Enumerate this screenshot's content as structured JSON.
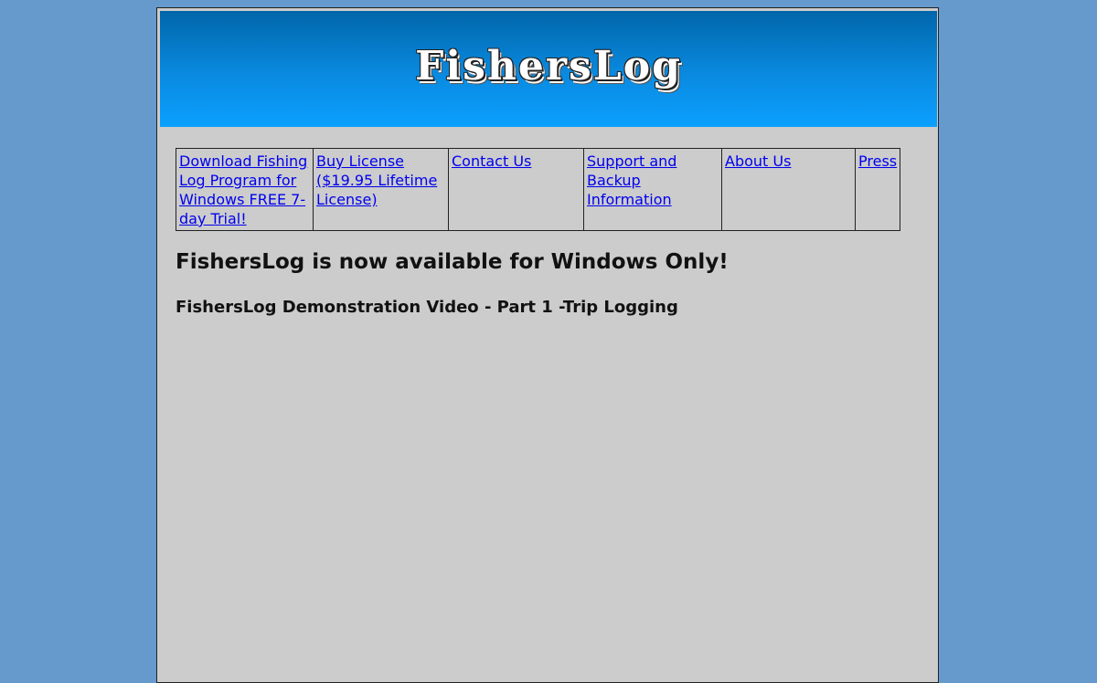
{
  "header": {
    "logo_text": "FishersLog",
    "gradient_top": "#0066aa",
    "gradient_bottom": "#0aa0ff"
  },
  "nav": {
    "items": [
      {
        "label": "Download Fishing Log Program for Windows  FREE 7-day Trial!"
      },
      {
        "label": "Buy License ($19.95 Lifetime License)"
      },
      {
        "label": "Contact Us"
      },
      {
        "label": "Support and Backup Information"
      },
      {
        "label": "About Us"
      },
      {
        "label": "Press"
      }
    ]
  },
  "main": {
    "headline": "FishersLog is now available for Windows Only!",
    "subheadline": "FishersLog Demonstration Video - Part 1 -Trip Logging"
  },
  "colors": {
    "page_background": "#6699cc",
    "content_background": "#cccccc",
    "link": "#0000ee"
  }
}
